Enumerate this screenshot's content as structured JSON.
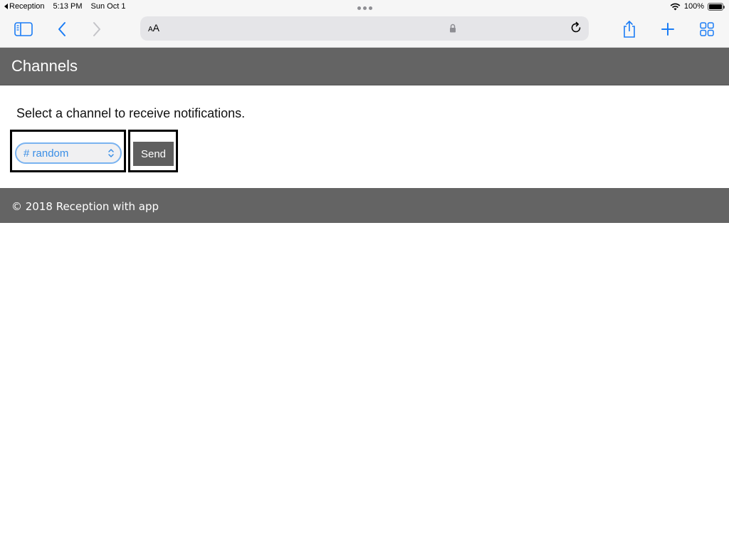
{
  "status_bar": {
    "back_app": "Reception",
    "time": "5:13 PM",
    "date": "Sun Oct 1",
    "battery": "100%",
    "battery_level": 1.0
  },
  "toolbar": {
    "icons": [
      "sidebar-icon",
      "back-icon",
      "forward-icon",
      "share-icon",
      "plus-icon",
      "tabs-icon"
    ],
    "reader_label_small": "A",
    "reader_label_large": "A",
    "accent_color": "#1a7cf5"
  },
  "page": {
    "title": "Channels",
    "instruction": "Select a channel to receive notifications.",
    "channel_select": {
      "selected": "# random"
    },
    "send_label": "Send",
    "footer": "© 2018 Reception with app"
  },
  "colors": {
    "header_bg": "#646464",
    "select_text": "#3a8ee6",
    "select_border": "#7ab3f0"
  }
}
